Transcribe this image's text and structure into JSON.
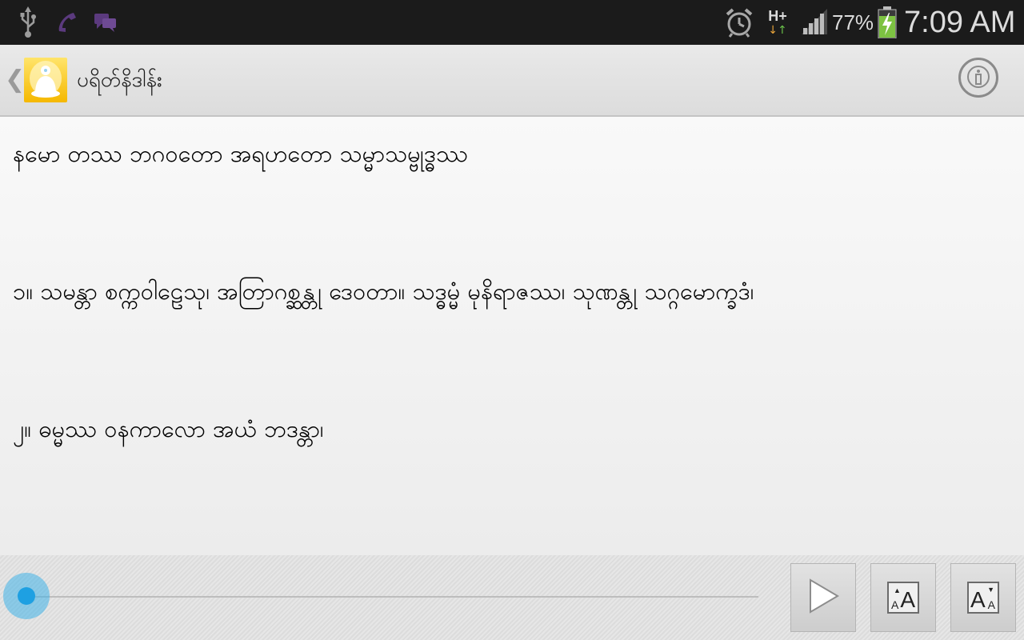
{
  "status_bar": {
    "icons": [
      "usb-icon",
      "phone-call-icon",
      "chat-icon",
      "alarm-icon",
      "network-type-icon",
      "signal-icon",
      "battery-charging-icon"
    ],
    "network_type": "H+",
    "battery_percent": "77%",
    "time": "7:09 AM"
  },
  "action_bar": {
    "title": "ပရိတ်နိဒါန်း",
    "icons": [
      "back-chevron-icon",
      "buddha-app-icon",
      "info-icon"
    ]
  },
  "content": {
    "verses": [
      "နမော တဿ ဘဂဝတော အရဟတော သမ္မာသမ္ဗုဒ္ဓဿ",
      "၁။ သမန္တာ စက္ကဝါဠေသု၊ အတြာဂစ္ဆန္တု ဒေဝတာ။ သဒ္ဓမ္မံ မုနိရာဇဿ၊ သုဏန္တု သဂ္ဂမောက္ခဒံ၊",
      "၂။ ဓမ္မဿ ဝနကာလော အယံ ဘဒန္တာ၊"
    ]
  },
  "controls": {
    "seek_progress": 0.0,
    "buttons": [
      "play-icon",
      "font-size-increase-icon",
      "font-size-decrease-icon"
    ]
  },
  "colors": {
    "status_bar_bg": "#1b1b1b",
    "action_bar_bg": "#e3e3e3",
    "accent_seek": "#1ea0e2",
    "app_icon_yellow": "#f5c400"
  }
}
